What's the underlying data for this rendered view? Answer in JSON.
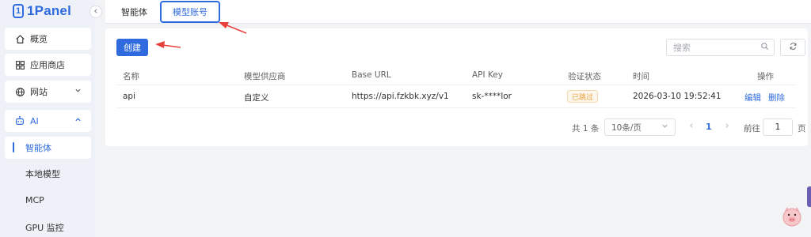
{
  "app": {
    "logo_text": "1Panel",
    "logo_mark": "1"
  },
  "sidebar": {
    "collapse_icon": "chevron-left-icon",
    "items": [
      {
        "label": "概览",
        "icon": "home-icon"
      },
      {
        "label": "应用商店",
        "icon": "grid-icon"
      },
      {
        "label": "网站",
        "icon": "globe-icon"
      },
      {
        "label": "AI",
        "icon": "robot-icon"
      }
    ],
    "ai_sub": [
      {
        "label": "智能体"
      },
      {
        "label": "本地模型"
      },
      {
        "label": "MCP"
      },
      {
        "label": "GPU 监控"
      }
    ]
  },
  "tabs": {
    "agent": "智能体",
    "model_account": "模型账号"
  },
  "toolbar": {
    "create_label": "创建",
    "search_placeholder": "搜索"
  },
  "table": {
    "headers": [
      "名称",
      "模型供应商",
      "Base URL",
      "API Key",
      "验证状态",
      "时间",
      "操作"
    ],
    "rows": [
      {
        "name": "api",
        "provider": "自定义",
        "base_url": "https://api.fzkbk.xyz/v1",
        "api_key": "sk-****lor",
        "status": "已跳过",
        "time": "2026-03-10 19:52:41",
        "edit": "编辑",
        "delete": "删除"
      }
    ]
  },
  "pagination": {
    "total": "共 1 条",
    "page_size": "10条/页",
    "current_page": "1",
    "goto_label": "前往",
    "goto_value": "1",
    "page_unit": "页"
  },
  "colors": {
    "primary": "#2f6bde",
    "warning": "#e6a23c",
    "arrow": "#e8413c"
  }
}
